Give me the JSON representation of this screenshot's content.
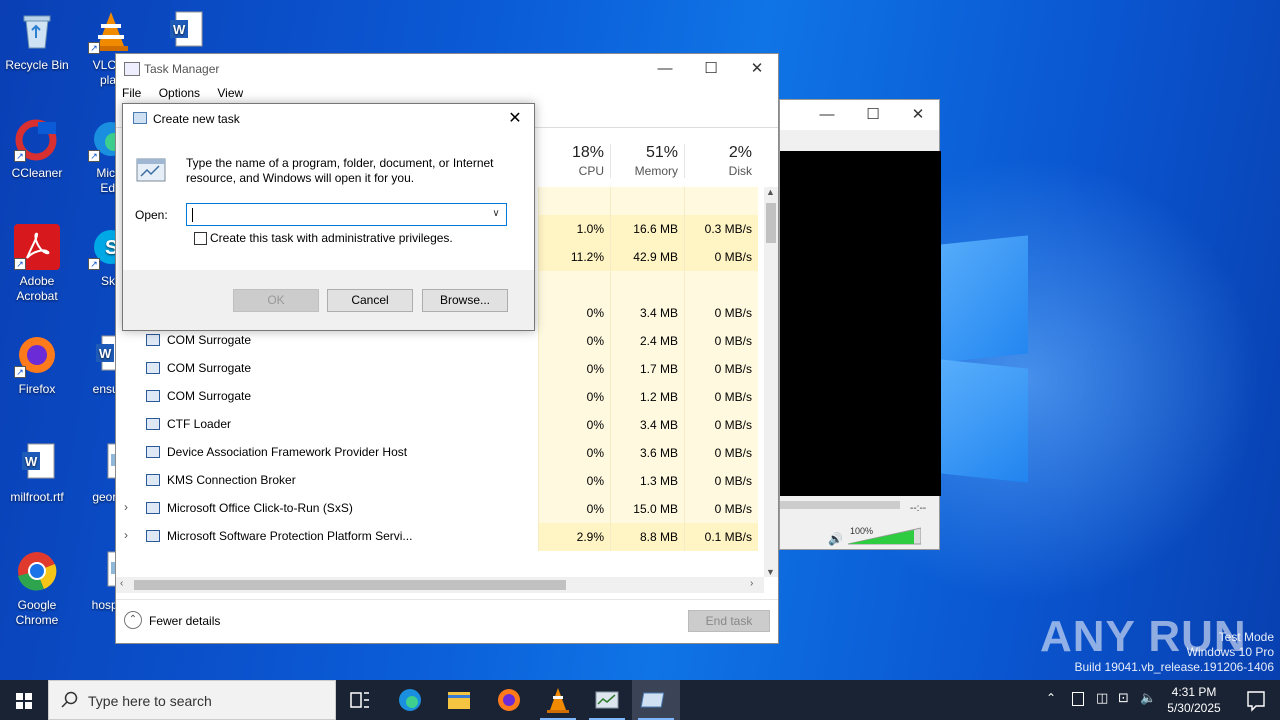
{
  "desktop": {
    "icons": [
      {
        "label": "Recycle Bin"
      },
      {
        "label": "VLC m\nplay"
      },
      {
        "label": "CCleaner"
      },
      {
        "label": "Micro\nEdg"
      },
      {
        "label": "Adobe\nAcrobat"
      },
      {
        "label": "Sky"
      },
      {
        "label": "Firefox"
      },
      {
        "label": "ensure"
      },
      {
        "label": "milfroot.rtf"
      },
      {
        "label": "george"
      },
      {
        "label": "Google\nChrome"
      },
      {
        "label": "hospita"
      }
    ]
  },
  "media_window": {
    "time": "--:--",
    "volume_label": "100%",
    "volume_level": 1.0
  },
  "task_manager": {
    "title": "Task Manager",
    "menu": [
      "File",
      "Options",
      "View"
    ],
    "columns": {
      "cpu": {
        "pct": "18%",
        "label": "CPU"
      },
      "memory": {
        "pct": "51%",
        "label": "Memory"
      },
      "disk": {
        "pct": "2%",
        "label": "Disk"
      }
    },
    "rows": [
      {
        "name": "",
        "cpu": "",
        "memory": "",
        "disk": "",
        "expandable": false,
        "highlight": false
      },
      {
        "name": "",
        "cpu": "1.0%",
        "memory": "16.6 MB",
        "disk": "0.3 MB/s",
        "expandable": false,
        "highlight": true
      },
      {
        "name": "",
        "cpu": "11.2%",
        "memory": "42.9 MB",
        "disk": "0 MB/s",
        "expandable": false,
        "highlight": true
      },
      {
        "name": "",
        "cpu": "",
        "memory": "",
        "disk": "",
        "expandable": false,
        "highlight": false
      },
      {
        "name": "Application Frame Host",
        "cpu": "0%",
        "memory": "3.4 MB",
        "disk": "0 MB/s",
        "expandable": false,
        "highlight": false
      },
      {
        "name": "COM Surrogate",
        "cpu": "0%",
        "memory": "2.4 MB",
        "disk": "0 MB/s",
        "expandable": false,
        "highlight": false
      },
      {
        "name": "COM Surrogate",
        "cpu": "0%",
        "memory": "1.7 MB",
        "disk": "0 MB/s",
        "expandable": false,
        "highlight": false
      },
      {
        "name": "COM Surrogate",
        "cpu": "0%",
        "memory": "1.2 MB",
        "disk": "0 MB/s",
        "expandable": false,
        "highlight": false
      },
      {
        "name": "CTF Loader",
        "cpu": "0%",
        "memory": "3.4 MB",
        "disk": "0 MB/s",
        "expandable": false,
        "highlight": false
      },
      {
        "name": "Device Association Framework Provider Host",
        "cpu": "0%",
        "memory": "3.6 MB",
        "disk": "0 MB/s",
        "expandable": false,
        "highlight": false
      },
      {
        "name": "KMS Connection Broker",
        "cpu": "0%",
        "memory": "1.3 MB",
        "disk": "0 MB/s",
        "expandable": false,
        "highlight": false
      },
      {
        "name": "Microsoft Office Click-to-Run (SxS)",
        "cpu": "0%",
        "memory": "15.0 MB",
        "disk": "0 MB/s",
        "expandable": true,
        "highlight": false
      },
      {
        "name": "Microsoft Software Protection Platform Servi...",
        "cpu": "2.9%",
        "memory": "8.8 MB",
        "disk": "0.1 MB/s",
        "expandable": true,
        "highlight": true
      }
    ],
    "fewer_details": "Fewer details",
    "end_task": "End task"
  },
  "dialog": {
    "title": "Create new task",
    "description": "Type the name of a program, folder, document, or Internet resource, and Windows will open it for you.",
    "open_label": "Open:",
    "open_value": "",
    "admin_checkbox_label": "Create this task with administrative privileges.",
    "admin_checked": false,
    "ok": "OK",
    "cancel": "Cancel",
    "browse": "Browse..."
  },
  "taskbar": {
    "search_placeholder": "Type here to search",
    "time": "4:31 PM",
    "date": "5/30/2025"
  },
  "watermark": {
    "brand": "ANY RUN",
    "line1": "Test Mode",
    "line2": "Windows 10 Pro",
    "line3": "Build 19041.vb_release.191206-1406"
  },
  "colors": {
    "highlight_row": "#fff4c4",
    "cell_bg": "#fff9e0",
    "accent": "#0078d7"
  }
}
